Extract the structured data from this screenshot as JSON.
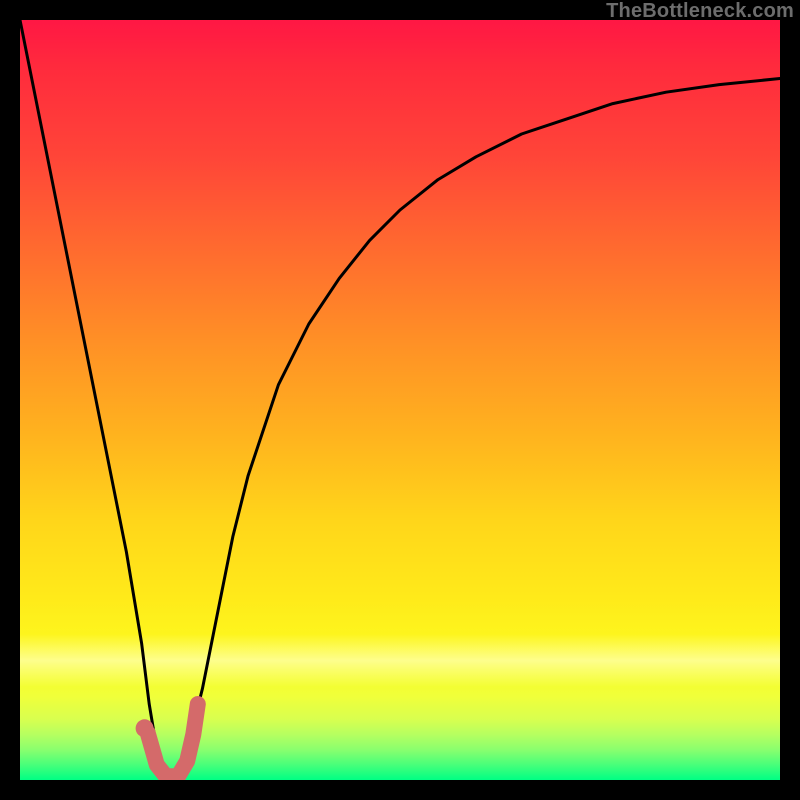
{
  "watermark": "TheBottleneck.com",
  "chart_data": {
    "type": "line",
    "title": "",
    "xlabel": "",
    "ylabel": "",
    "xlim": [
      0,
      100
    ],
    "ylim": [
      0,
      100
    ],
    "grid": false,
    "legend": false,
    "series": [
      {
        "name": "bottleneck-curve",
        "x": [
          0,
          2,
          4,
          6,
          8,
          10,
          12,
          14,
          16,
          17,
          18,
          19,
          20,
          21,
          22,
          24,
          26,
          28,
          30,
          34,
          38,
          42,
          46,
          50,
          55,
          60,
          66,
          72,
          78,
          85,
          92,
          100
        ],
        "y": [
          100,
          90,
          80,
          70,
          60,
          50,
          40,
          30,
          18,
          10,
          4,
          1,
          0,
          1,
          4,
          12,
          22,
          32,
          40,
          52,
          60,
          66,
          71,
          75,
          79,
          82,
          85,
          87,
          89,
          90.5,
          91.5,
          92.3
        ]
      }
    ],
    "marker": {
      "name": "J-marker",
      "points_xy": [
        [
          16.8,
          6.2
        ],
        [
          18.0,
          2.0
        ],
        [
          19.2,
          0.5
        ],
        [
          20.8,
          0.5
        ],
        [
          22.0,
          2.5
        ],
        [
          22.8,
          6.0
        ],
        [
          23.4,
          10.0
        ]
      ],
      "dot_xy": [
        16.4,
        6.8
      ],
      "color": "#d46a6a",
      "stroke_width_px": 16
    },
    "background_gradient": {
      "orientation": "vertical",
      "stops": [
        {
          "pos": 0.0,
          "color": "#ff1744"
        },
        {
          "pos": 0.3,
          "color": "#ff6a2f"
        },
        {
          "pos": 0.55,
          "color": "#ffb41e"
        },
        {
          "pos": 0.76,
          "color": "#ffea1a"
        },
        {
          "pos": 0.89,
          "color": "#f0ff3a"
        },
        {
          "pos": 1.0,
          "color": "#00ff84"
        }
      ]
    }
  }
}
